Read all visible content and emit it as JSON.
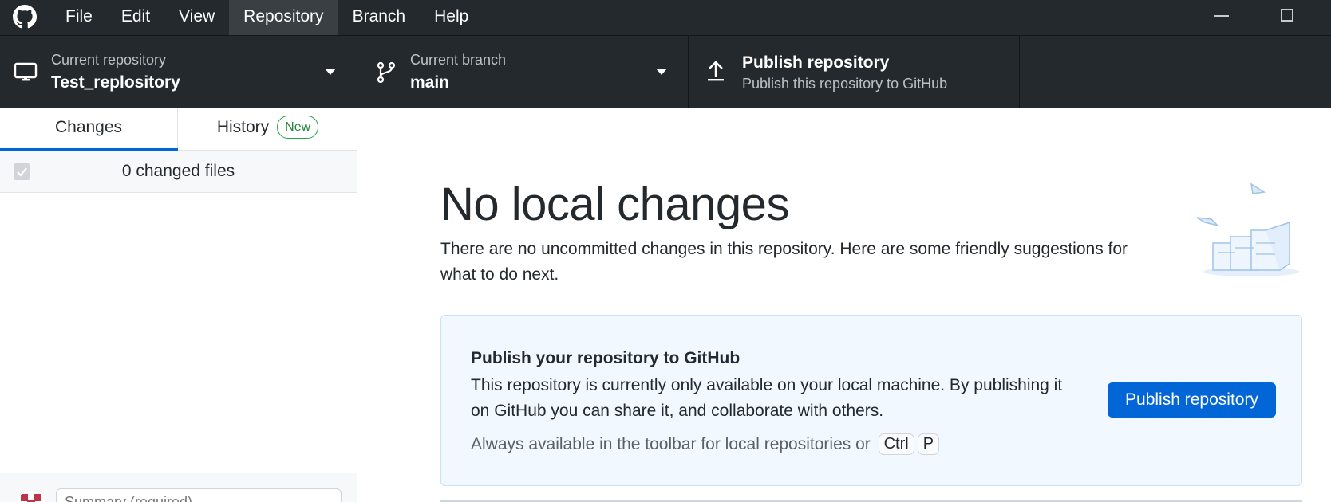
{
  "menu": {
    "items": [
      "File",
      "Edit",
      "View",
      "Repository",
      "Branch",
      "Help"
    ],
    "active": "Repository"
  },
  "toolbar": {
    "repository": {
      "description": "Current repository",
      "title": "Test_replository",
      "icon": "computer-icon"
    },
    "branch": {
      "description": "Current branch",
      "title": "main",
      "icon": "git-branch-icon"
    },
    "publish": {
      "title": "Publish repository",
      "description": "Publish this repository to GitHub",
      "icon": "upload-icon"
    }
  },
  "sidebar": {
    "tabs": {
      "changes": "Changes",
      "history": "History",
      "history_badge": "New"
    },
    "files_count": "0 changed files",
    "summary_placeholder": "Summary (required)"
  },
  "main": {
    "heading": "No local changes",
    "description": "There are no uncommitted changes in this repository. Here are some friendly suggestions for what to do next.",
    "publish_card": {
      "title": "Publish your repository to GitHub",
      "body": "This repository is currently only available on your local machine. By publishing it on GitHub you can share it, and collaborate with others.",
      "hint": "Always available in the toolbar for local repositories or",
      "shortcut_keys": [
        "Ctrl",
        "P"
      ],
      "button": "Publish repository"
    }
  },
  "colors": {
    "toolbar_bg": "#24292e",
    "accent": "#0366d6",
    "badge_green": "#28a745",
    "card_bg": "#f1f8ff"
  }
}
